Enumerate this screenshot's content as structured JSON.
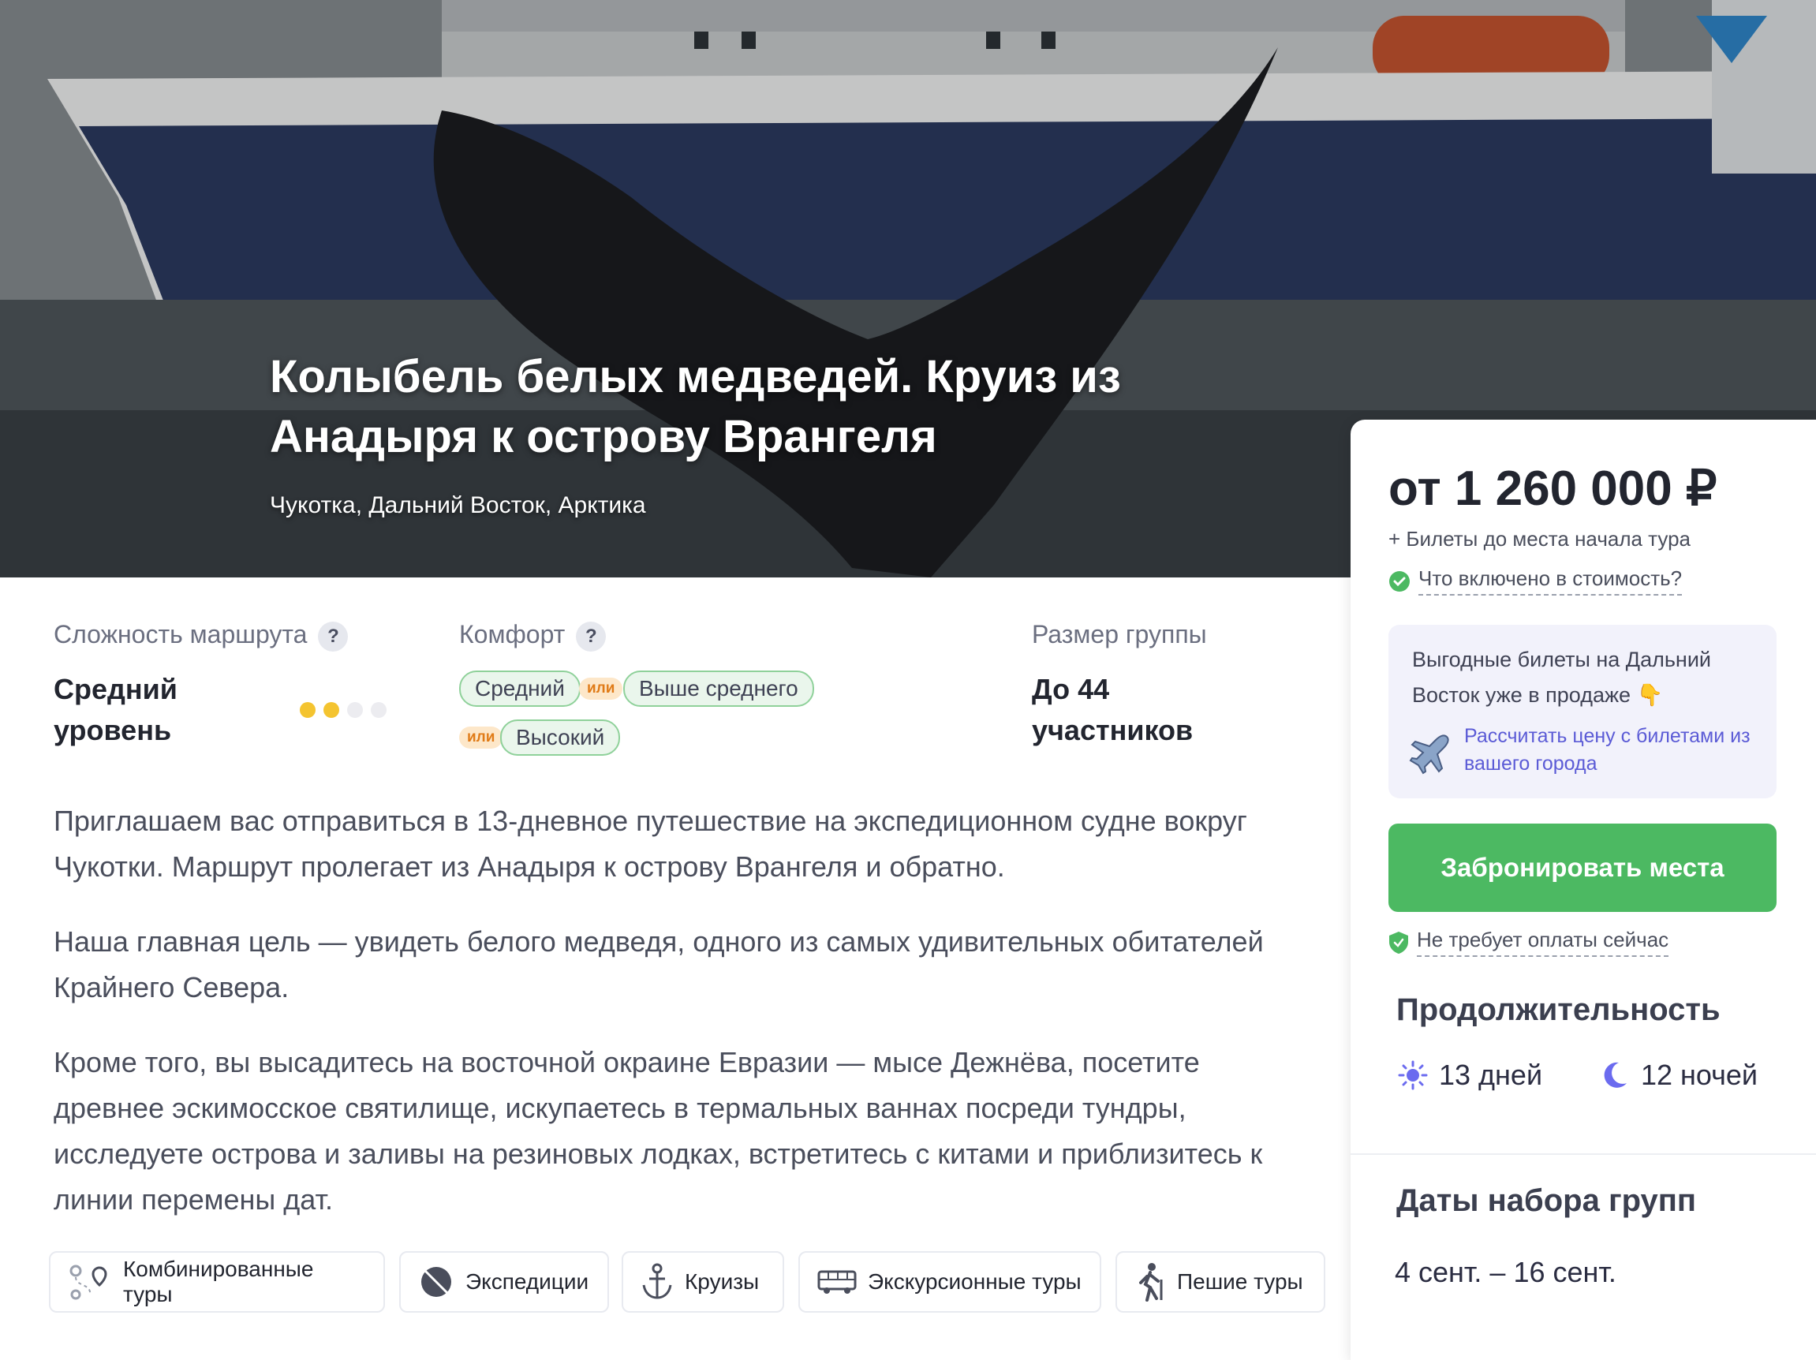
{
  "hero": {
    "title_line1": "Колыбель белых медведей. Круиз из",
    "title_line2": "Анадыря к острову Врангеля",
    "subtitle": "Чукотка, Дальний Восток, Арктика"
  },
  "info": {
    "difficulty": {
      "label": "Сложность маршрута",
      "value_line1": "Средний",
      "value_line2": "уровень",
      "level_filled": 2,
      "level_total": 4,
      "help": "?"
    },
    "comfort": {
      "label": "Комфорт",
      "help": "?",
      "options": [
        "Средний",
        "Выше среднего",
        "Высокий"
      ],
      "or_label": "или"
    },
    "group": {
      "label": "Размер группы",
      "value_line1": "До 44",
      "value_line2": "участников"
    }
  },
  "description": [
    "Приглашаем вас отправиться в 13-дневное путешествие на экспедиционном судне вокруг Чукотки. Маршрут пролегает из Анадыря к острову Врангеля и обратно.",
    "Наша главная цель — увидеть белого медведя, одного из самых удивительных обитателей Крайнего Севера.",
    "Кроме того, вы высадитесь на восточной окраине Евразии — мысе Дежнёва, посетите древнее эскимосское святилище, искупаетесь в термальных ваннах посреди тундры, исследуете острова и заливы на резиновых лодках, встретитесь с китами и приблизитесь к линии перемены дат."
  ],
  "tags": [
    {
      "label": "Комбинированные туры",
      "icon": "route-icon"
    },
    {
      "label": "Экспедиции",
      "icon": "compass-icon"
    },
    {
      "label": "Круизы",
      "icon": "anchor-icon"
    },
    {
      "label": "Экскурсионные туры",
      "icon": "bus-icon"
    },
    {
      "label": "Пешие туры",
      "icon": "hiker-icon"
    }
  ],
  "booking": {
    "price": "от 1 260 000 ₽",
    "tickets_note": "+ Билеты до места начала тура",
    "included_link": "Что включено в стоимость?",
    "promo_text": "Выгодные билеты на Дальний Восток уже в продаже 👇",
    "promo_link": "Рассчитать цену с билетами из вашего города",
    "book_button": "Забронировать места",
    "no_payment": "Не требует оплаты сейчас",
    "duration_title": "Продолжительность",
    "days": "13 дней",
    "nights": "12 ночей",
    "dates_title": "Даты набора групп",
    "dates": "4 сент. – 16 сент."
  },
  "colors": {
    "accent_green": "#4cb962",
    "link_purple": "#5b5bd6",
    "level_dot": "#f4c430",
    "pill_border": "#8fd19a"
  }
}
